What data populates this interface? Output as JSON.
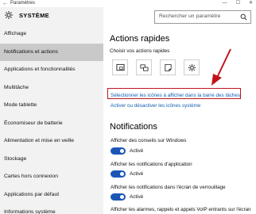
{
  "window": {
    "title": "Paramètres",
    "controls": [
      "—",
      "☐",
      "✕"
    ]
  },
  "sidebar": {
    "header": "SYSTÈME",
    "items": [
      {
        "label": "Affichage",
        "selected": false
      },
      {
        "label": "Notifications et actions",
        "selected": true
      },
      {
        "label": "Applications et fonctionnalités",
        "selected": false
      },
      {
        "label": "Multitâche",
        "selected": false
      },
      {
        "label": "Mode tablette",
        "selected": false
      },
      {
        "label": "Économiseur de batterie",
        "selected": false
      },
      {
        "label": "Alimentation et mise en veille",
        "selected": false
      },
      {
        "label": "Stockage",
        "selected": false
      },
      {
        "label": "Cartes hors connexion",
        "selected": false
      },
      {
        "label": "Applications par défaut",
        "selected": false
      },
      {
        "label": "Informations système",
        "selected": false
      }
    ]
  },
  "search": {
    "placeholder": "Rechercher un paramètre"
  },
  "main": {
    "quick_actions_title": "Actions rapides",
    "quick_actions_subtitle": "Choisir vos actions rapides",
    "quick_action_icons": [
      "tablet-mode-icon",
      "project-icon",
      "note-icon",
      "settings-icon"
    ],
    "link_select_icons": "Sélectionner les icônes à afficher dans la barre des tâches",
    "link_toggle_system_icons": "Activer ou désactiver les icônes système",
    "notifications_title": "Notifications",
    "options": [
      {
        "label": "Afficher des conseils sur Windows",
        "state": "Activé"
      },
      {
        "label": "Afficher les notifications d'application",
        "state": "Activé"
      },
      {
        "label": "Afficher les notifications dans l'écran de verrouillage",
        "state": "Activé"
      },
      {
        "label": "Afficher les alarmes, rappels et appels VoIP entrants sur l'écran"
      }
    ]
  },
  "colors": {
    "accent": "#1a56b8",
    "link": "#1060b0",
    "highlight": "#c0141c",
    "sidebar_bg": "#f2f2f2",
    "selected_bg": "#c9c9c9"
  }
}
